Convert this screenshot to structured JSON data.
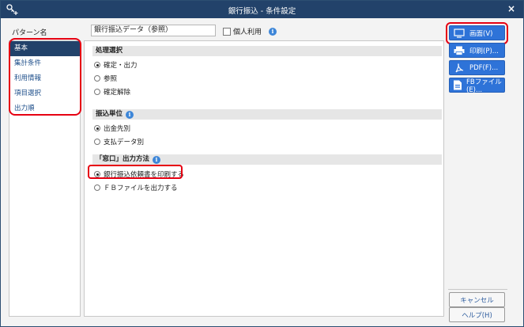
{
  "window": {
    "title": "銀行振込 - 条件設定",
    "close_label": "×"
  },
  "pattern": {
    "label": "パターン名",
    "value": "銀行振込データ（参照）",
    "personal_label": "個人利用"
  },
  "sidebar": {
    "items": [
      {
        "label": "基本",
        "active": true
      },
      {
        "label": "集計条件"
      },
      {
        "label": "利用情報"
      },
      {
        "label": "項目選択"
      },
      {
        "label": "出力順"
      }
    ]
  },
  "sections": {
    "process": {
      "title": "処理選択",
      "options": [
        {
          "label": "確定・出力",
          "selected": true
        },
        {
          "label": "参照"
        },
        {
          "label": "確定解除"
        }
      ]
    },
    "unit": {
      "title": "振込単位",
      "options": [
        {
          "label": "出金先別",
          "selected": true
        },
        {
          "label": "支払データ別"
        }
      ]
    },
    "window_output": {
      "title": "「窓口」出力方法",
      "options": [
        {
          "label": "銀行振込依頼書を印刷する",
          "selected": true
        },
        {
          "label": "ＦＢファイルを出力する"
        }
      ]
    }
  },
  "buttons": {
    "screen": "画面(V)",
    "print": "印刷(P)...",
    "pdf": "PDF(F)...",
    "fb": "FBファイル(E)...",
    "cancel": "キャンセル",
    "help": "ヘルプ(H)"
  },
  "colors": {
    "title_bar": "#22426a",
    "accent": "#2e73d8",
    "highlight": "#e60012"
  }
}
